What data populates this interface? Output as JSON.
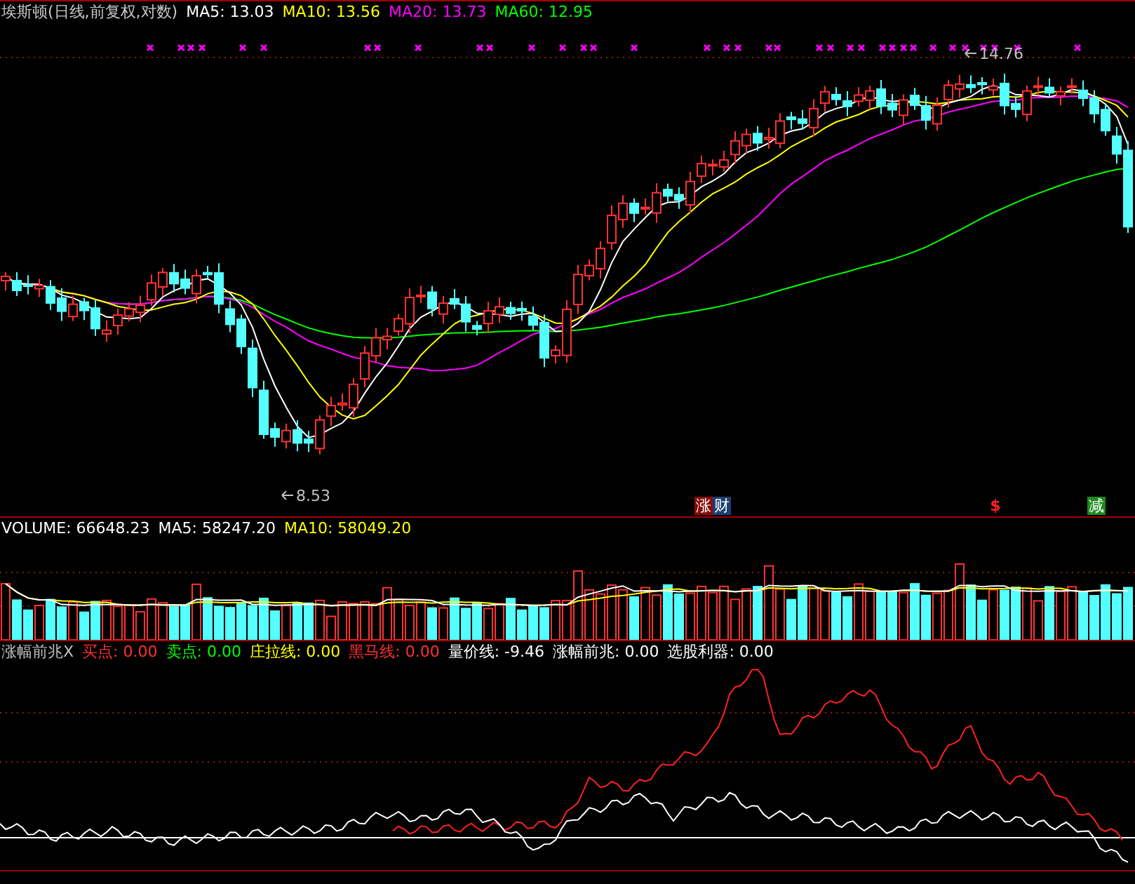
{
  "price_panel": {
    "title": "埃斯顿(日线,前复权,对数)",
    "indicators": [
      {
        "label": "MA5: 13.03",
        "color": "#ffffff"
      },
      {
        "label": "MA10: 13.56",
        "color": "#ffff00"
      },
      {
        "label": "MA20: 13.73",
        "color": "#ff00ff"
      },
      {
        "label": "MA60: 12.95",
        "color": "#00ff00"
      }
    ],
    "high_label": "14.76",
    "low_label": "8.53",
    "badges": [
      {
        "kind": "tag",
        "text": "涨",
        "color": "#8b0a0a"
      },
      {
        "kind": "tag",
        "text": "财",
        "color": "#1c3f73"
      },
      {
        "kind": "dollar",
        "text": "$",
        "color": "#ff2020"
      },
      {
        "kind": "tag",
        "text": "减",
        "color": "#1f8a1f"
      }
    ]
  },
  "volume_panel": {
    "indicators": [
      {
        "label": "VOLUME: 66648.23",
        "color": "#ffffff"
      },
      {
        "label": "MA5: 58247.20",
        "color": "#ffffff"
      },
      {
        "label": "MA10: 58049.20",
        "color": "#ffff00"
      }
    ]
  },
  "signal_panel": {
    "indicators": [
      {
        "label": "涨幅前兆X",
        "color": "#c0c0c0"
      },
      {
        "label": "买点: 0.00",
        "color": "#ff3030"
      },
      {
        "label": "卖点: 0.00",
        "color": "#00ff00"
      },
      {
        "label": "庄拉线: 0.00",
        "color": "#ffff00"
      },
      {
        "label": "黑马线: 0.00",
        "color": "#ff3030"
      },
      {
        "label": "量价线: -9.46",
        "color": "#ffffff"
      },
      {
        "label": "涨幅前兆: 0.00",
        "color": "#ffffff"
      },
      {
        "label": "选股利器: 0.00",
        "color": "#ffffff"
      }
    ]
  }
}
